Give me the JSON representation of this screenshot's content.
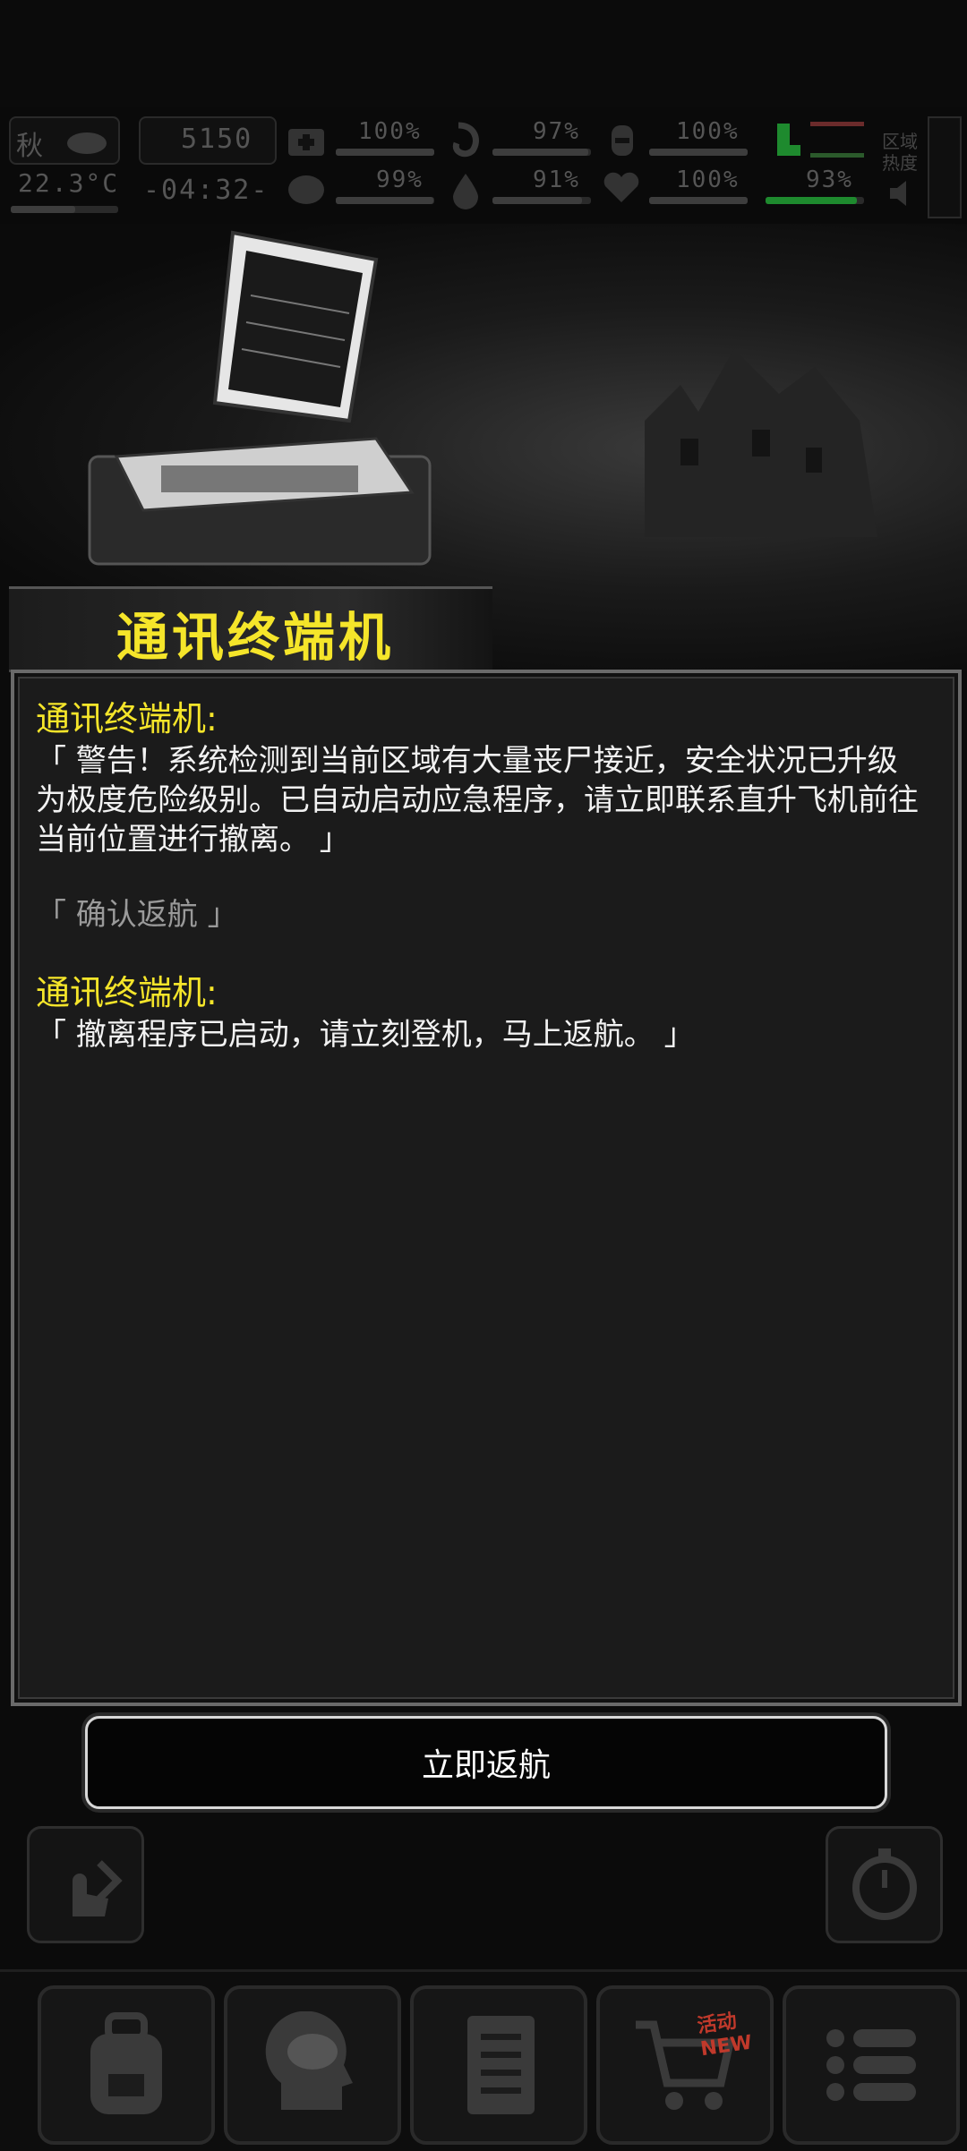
{
  "status": {
    "season": "秋",
    "temperature": "22.3°C",
    "day_counter": "5150",
    "clock": "-04:32-",
    "stats_top": [
      "100%",
      "97%",
      "100%"
    ],
    "stats_bottom": [
      "99%",
      "91%",
      "100%",
      "93%"
    ],
    "region_label_1": "区域",
    "region_label_2": "热度"
  },
  "event": {
    "title": "通讯终端机"
  },
  "dialog": [
    {
      "speaker": "通讯终端机:",
      "text": "「 警告！系统检测到当前区域有大量丧尸接近，安全状况已升级为极度危险级别。已自动启动应急程序，请立即联系直升飞机前往当前位置进行撤离。 」"
    },
    {
      "choice": "「 确认返航 」"
    },
    {
      "speaker": "通讯终端机:",
      "text": "「 撤离程序已启动，请立刻登机，马上返航。 」"
    }
  ],
  "actions": {
    "confirm_label": "立即返航"
  },
  "nav": {
    "badge": "活动 NEW"
  },
  "colors": {
    "accent_yellow": "#f5e52a",
    "health_green": "#1e8a2e"
  }
}
